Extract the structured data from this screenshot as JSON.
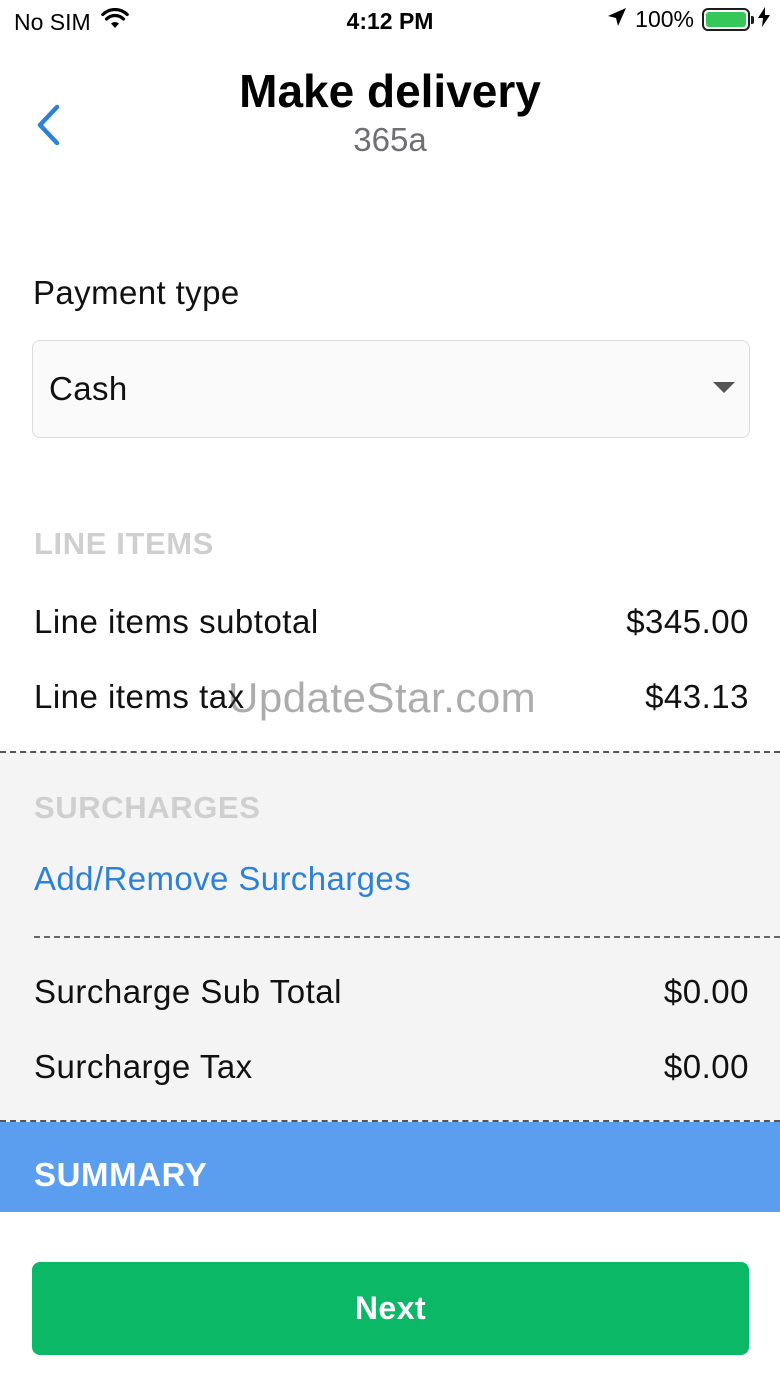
{
  "status_bar": {
    "carrier": "No SIM",
    "time": "4:12 PM",
    "battery_percent": "100%",
    "battery_level": 1.0,
    "icons": [
      "wifi-icon",
      "location-arrow-icon",
      "battery-icon",
      "charging-bolt-icon"
    ]
  },
  "header": {
    "title": "Make delivery",
    "subtitle": "365a",
    "back_icon": "chevron-left-icon"
  },
  "payment": {
    "label": "Payment type",
    "selected": "Cash",
    "caret_icon": "caret-down-icon"
  },
  "line_items": {
    "title": "LINE ITEMS",
    "rows": [
      {
        "label": "Line items subtotal",
        "value": "$345.00"
      },
      {
        "label": "Line items tax",
        "value": "$43.13"
      }
    ]
  },
  "surcharges": {
    "title": "SURCHARGES",
    "link": "Add/Remove Surcharges",
    "rows": [
      {
        "label": "Surcharge Sub Total",
        "value": "$0.00"
      },
      {
        "label": "Surcharge Tax",
        "value": "$0.00"
      }
    ]
  },
  "summary": {
    "title": "SUMMARY"
  },
  "footer": {
    "next_label": "Next"
  },
  "watermark": "UpdateStar.com",
  "colors": {
    "accent_blue": "#2e82d6",
    "summary_blue": "#5b9ef0",
    "next_green": "#0ab865",
    "battery_green": "#35c759",
    "section_gray": "#cfcfcf"
  }
}
